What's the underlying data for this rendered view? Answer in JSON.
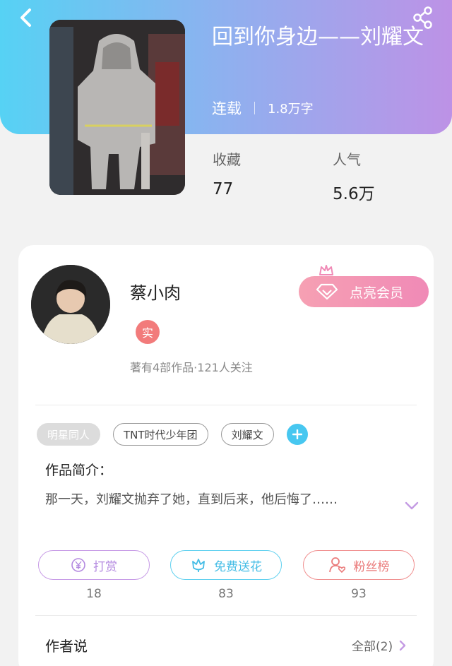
{
  "header": {
    "back_icon": "chevron-left-icon",
    "share_icon": "share-icon"
  },
  "book": {
    "title": "回到你身边——刘耀文",
    "status": "连载",
    "word_count": "1.8万字",
    "stats": {
      "favorites_label": "收藏",
      "favorites_value": "77",
      "popularity_label": "人气",
      "popularity_value": "5.6万"
    }
  },
  "author": {
    "name": "蔡小肉",
    "badge": "实",
    "stats_text": "著有4部作品·121人关注",
    "vip_button": "点亮会员"
  },
  "tags": [
    "明星同人",
    "TNT时代少年团",
    "刘耀文"
  ],
  "synopsis": {
    "title": "作品简介：",
    "text": "那一天，刘耀文抛弃了她，直到后来，他后悔了……"
  },
  "actions": [
    {
      "label": "打赏",
      "count": "18",
      "icon": "yen-icon"
    },
    {
      "label": "免费送花",
      "count": "83",
      "icon": "flower-icon"
    },
    {
      "label": "粉丝榜",
      "count": "93",
      "icon": "fan-rank-icon"
    }
  ],
  "author_says": {
    "title": "作者说",
    "see_all": "全部(2)"
  },
  "colors": {
    "header_gradient_start": "#56d2f4",
    "header_gradient_end": "#bd92e6",
    "vip": "#f08ab6",
    "tip": "#c79be6",
    "flower": "#5fd0ef",
    "fans": "#f08f8f"
  }
}
